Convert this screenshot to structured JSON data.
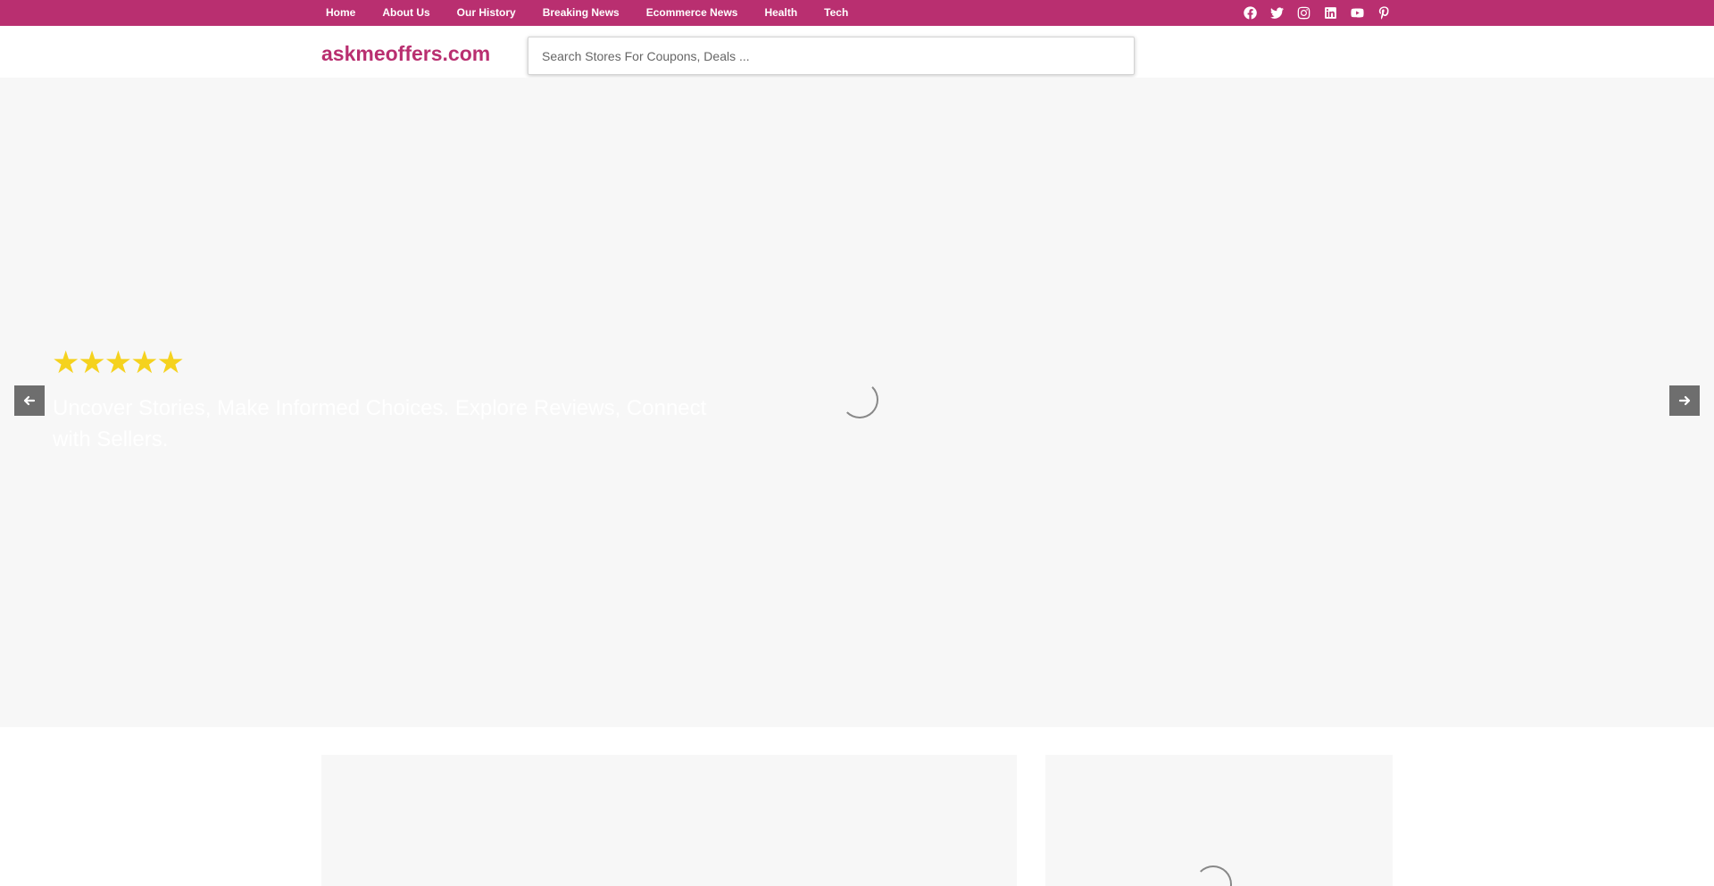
{
  "topnav": {
    "items": [
      {
        "label": "Home"
      },
      {
        "label": "About Us"
      },
      {
        "label": "Our History"
      },
      {
        "label": "Breaking News"
      },
      {
        "label": "Ecommerce News"
      },
      {
        "label": "Health"
      },
      {
        "label": "Tech"
      }
    ],
    "social_icons": [
      "facebook-icon",
      "twitter-icon",
      "instagram-icon",
      "linkedin-icon",
      "youtube-icon",
      "pinterest-icon"
    ],
    "background_color": "#b92f70"
  },
  "header": {
    "logo": "askmeoffers.com",
    "logo_color": "#b92f70",
    "search_placeholder": "Search Stores For Coupons, Deals ..."
  },
  "hero": {
    "rating_stars": 5,
    "stars": "★★★★★",
    "star_color": "#f5d21e",
    "caption": "Uncover Stories, Make Informed Choices. Explore Reviews, Connect with Sellers.",
    "prev_icon": "arrow-left-icon",
    "next_icon": "arrow-right-icon",
    "loading": true
  }
}
